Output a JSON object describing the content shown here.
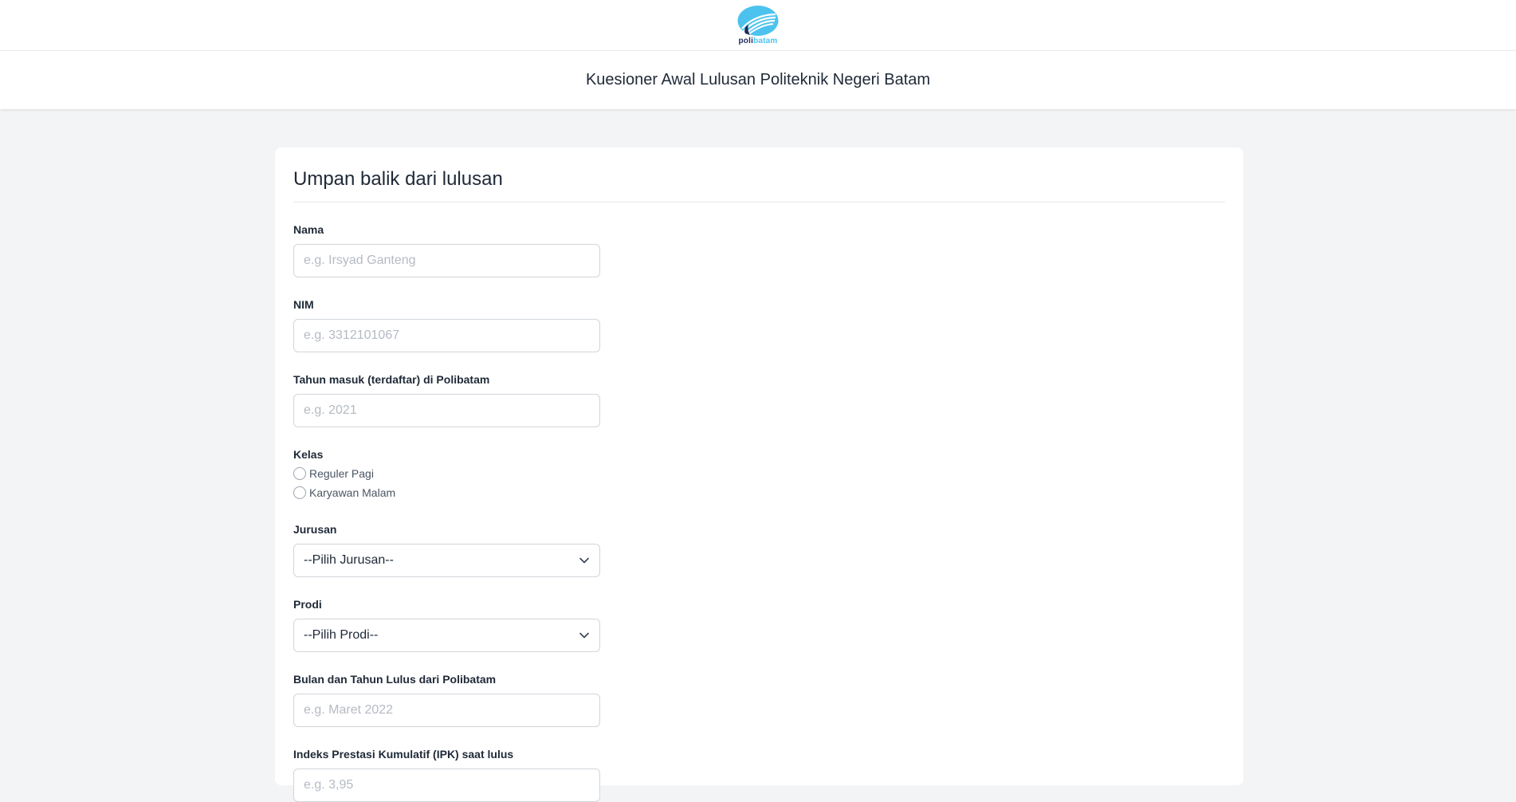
{
  "header": {
    "logo_text_poli": "poli",
    "logo_text_batam": "batam",
    "logo_icon": "polibatam-logo-icon",
    "brand_colors": {
      "navy": "#1e2a5a",
      "sky": "#4cc3ee"
    }
  },
  "titlebar": {
    "title": "Kuesioner Awal Lulusan Politeknik Negeri Batam"
  },
  "form": {
    "heading": "Umpan balik dari lulusan",
    "nama": {
      "label": "Nama",
      "placeholder": "e.g. Irsyad Ganteng",
      "value": ""
    },
    "nim": {
      "label": "NIM",
      "placeholder": "e.g. 3312101067",
      "value": ""
    },
    "tahun_masuk": {
      "label": "Tahun masuk (terdaftar) di Polibatam",
      "placeholder": "e.g. 2021",
      "value": ""
    },
    "kelas": {
      "label": "Kelas",
      "options": [
        "Reguler Pagi",
        "Karyawan Malam"
      ]
    },
    "jurusan": {
      "label": "Jurusan",
      "selected": "--Pilih Jurusan--",
      "icon": "chevron-down-icon"
    },
    "prodi": {
      "label": "Prodi",
      "selected": "--Pilih Prodi--",
      "icon": "chevron-down-icon"
    },
    "bulan_tahun_lulus": {
      "label": "Bulan dan Tahun Lulus dari Polibatam",
      "placeholder": "e.g. Maret 2022",
      "value": ""
    },
    "ipk": {
      "label": "Indeks Prestasi Kumulatif (IPK) saat lulus",
      "placeholder": "e.g. 3,95",
      "value": ""
    }
  }
}
